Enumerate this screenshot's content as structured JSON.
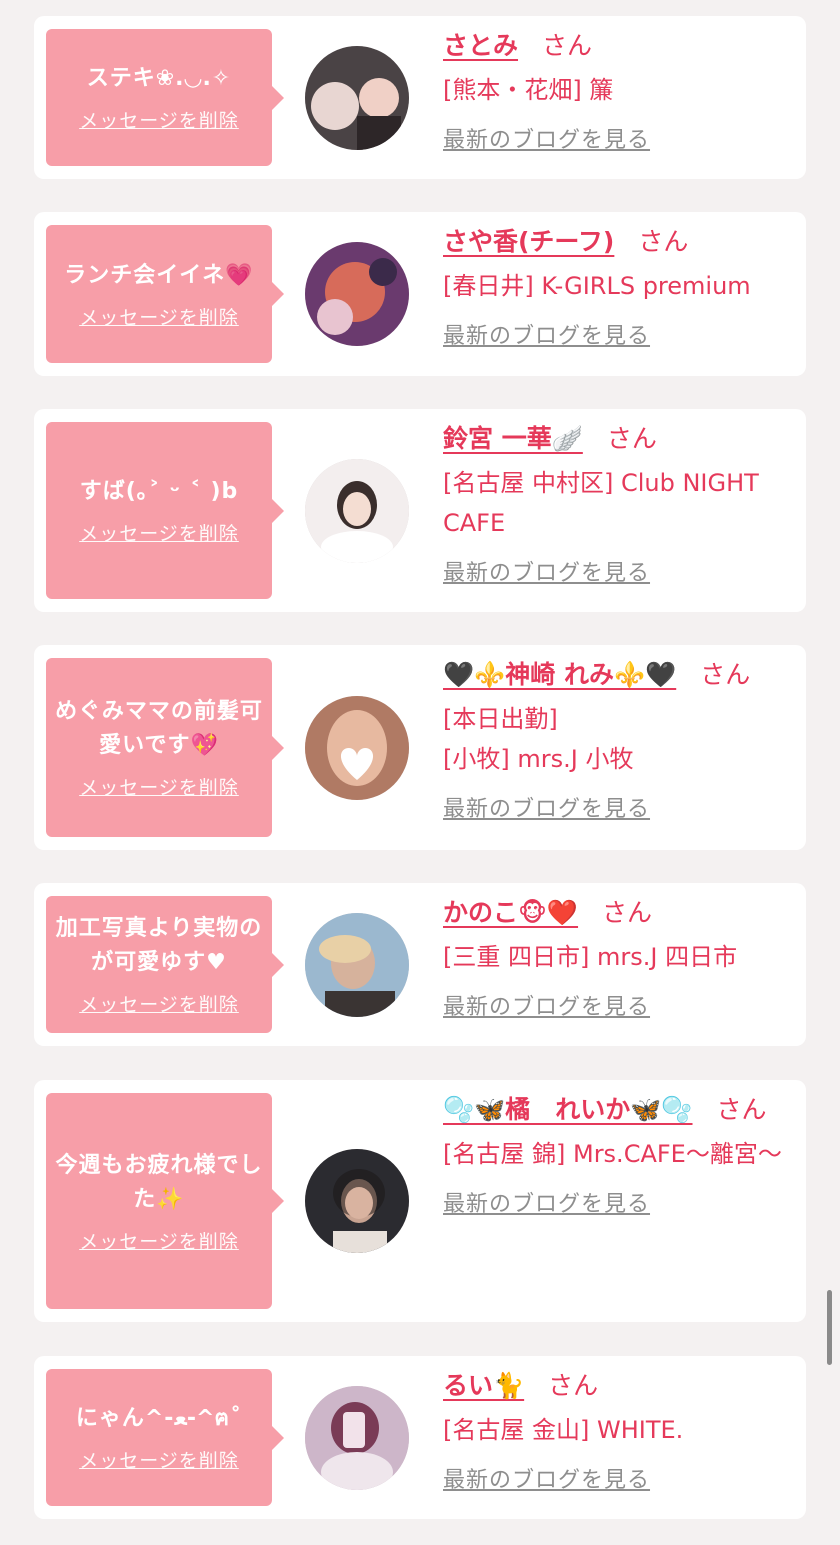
{
  "delete_label": "メッセージを削除",
  "blog_label": "最新のブログを見る",
  "honorific": "さん",
  "entries": [
    {
      "message": "ステキ❀.◡.✧",
      "name": "さとみ",
      "lines": [
        "[熊本・花畑] 簾"
      ],
      "avatar_colors": [
        "#4a4345",
        "#e8d6d2"
      ]
    },
    {
      "message": "ランチ会イイネ💗",
      "name": "さや香(チーフ)",
      "lines": [
        "[春日井] K-GIRLS premium"
      ],
      "avatar_colors": [
        "#6a3a6e",
        "#d76b5a"
      ]
    },
    {
      "message": "すば(｡˃ ᵕ ˂ )b",
      "name": "鈴宮 一華🪽",
      "lines": [
        "[名古屋 中村区] Club NIGHT CAFE"
      ],
      "avatar_colors": [
        "#f3eeee",
        "#3a2e2c"
      ]
    },
    {
      "message": "めぐみママの前髪可愛いです💖",
      "name": "🖤⚜️神崎 れみ⚜️🖤",
      "lines": [
        "[本日出勤]",
        "[小牧] mrs.J 小牧"
      ],
      "avatar_colors": [
        "#b07a64",
        "#ffffff"
      ]
    },
    {
      "message": "加工写真より実物のが可愛ゆす♥",
      "name": "かのこ🐵❤️",
      "lines": [
        "[三重 四日市] mrs.J 四日市"
      ],
      "avatar_colors": [
        "#9bb8cf",
        "#d6b29c"
      ]
    },
    {
      "message": "今週もお疲れ様でした✨",
      "name": "🫧🦋橘　れいか🦋🫧",
      "lines": [
        "[名古屋 錦] Mrs.CAFE～離宮～"
      ],
      "avatar_colors": [
        "#2b2b30",
        "#c8a391"
      ]
    },
    {
      "message": "にゃん^-ﻌ-^ฅ˚",
      "name": "るい🐈",
      "lines": [
        "[名古屋 金山] WHITE."
      ],
      "avatar_colors": [
        "#cdb6c9",
        "#7a3b56"
      ]
    }
  ]
}
